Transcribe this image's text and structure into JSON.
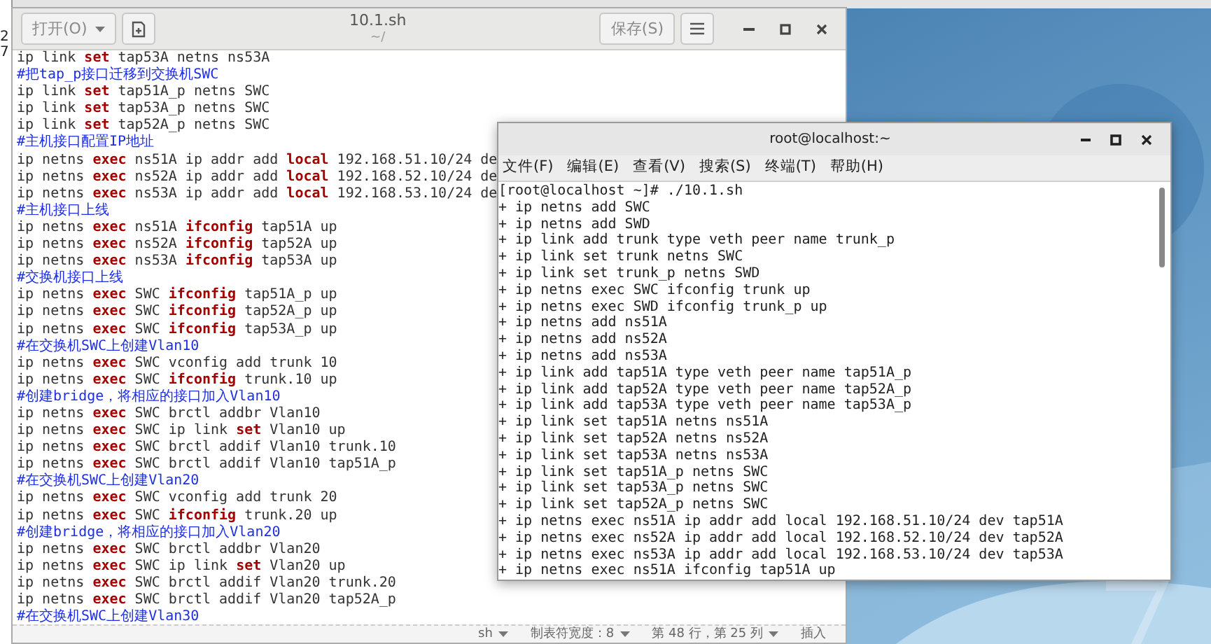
{
  "background_window": {
    "fragments": [
      "2",
      "7"
    ]
  },
  "editor": {
    "open_button": "打开(O)",
    "title": "10.1.sh",
    "subtitle": "~/",
    "save_button": "保存(S)",
    "lines": [
      {
        "kind": "code",
        "text": "ip link **set** tap53A netns ns53A"
      },
      {
        "kind": "comment",
        "text": "#把tap_p接口迁移到交换机SWC"
      },
      {
        "kind": "code",
        "text": "ip link **set** tap51A_p netns SWC"
      },
      {
        "kind": "code",
        "text": "ip link **set** tap53A_p netns SWC"
      },
      {
        "kind": "code",
        "text": "ip link **set** tap52A_p netns SWC"
      },
      {
        "kind": "comment",
        "text": "#主机接口配置IP地址"
      },
      {
        "kind": "code",
        "text": "ip netns **exec** ns51A ip addr add **local** 192.168.51.10/24 de"
      },
      {
        "kind": "code",
        "text": "ip netns **exec** ns52A ip addr add **local** 192.168.52.10/24 de"
      },
      {
        "kind": "code",
        "text": "ip netns **exec** ns53A ip addr add **local** 192.168.53.10/24 de"
      },
      {
        "kind": "comment",
        "text": "#主机接口上线"
      },
      {
        "kind": "code",
        "text": "ip netns **exec** ns51A **ifconfig** tap51A up"
      },
      {
        "kind": "code",
        "text": "ip netns **exec** ns52A **ifconfig** tap52A up"
      },
      {
        "kind": "code",
        "text": "ip netns **exec** ns53A **ifconfig** tap53A up"
      },
      {
        "kind": "comment",
        "text": "#交换机接口上线"
      },
      {
        "kind": "code",
        "text": "ip netns **exec** SWC **ifconfig** tap51A_p up"
      },
      {
        "kind": "code",
        "text": "ip netns **exec** SWC **ifconfig** tap52A_p up"
      },
      {
        "kind": "code",
        "text": "ip netns **exec** SWC **ifconfig** tap53A_p up"
      },
      {
        "kind": "comment",
        "text": "#在交换机SWC上创建Vlan10"
      },
      {
        "kind": "code",
        "text": "ip netns **exec** SWC vconfig add trunk 10"
      },
      {
        "kind": "code",
        "text": "ip netns **exec** SWC **ifconfig** trunk.10 up"
      },
      {
        "kind": "comment",
        "text": "#创建bridge，将相应的接口加入Vlan10"
      },
      {
        "kind": "code",
        "text": "ip netns **exec** SWC brctl addbr Vlan10"
      },
      {
        "kind": "code",
        "text": "ip netns **exec** SWC ip link **set** Vlan10 up"
      },
      {
        "kind": "code",
        "text": "ip netns **exec** SWC brctl addif Vlan10 trunk.10"
      },
      {
        "kind": "code",
        "text": "ip netns **exec** SWC brctl addif Vlan10 tap51A_p"
      },
      {
        "kind": "comment",
        "text": "#在交换机SWC上创建Vlan20"
      },
      {
        "kind": "code",
        "text": "ip netns **exec** SWC vconfig add trunk 20"
      },
      {
        "kind": "code",
        "text": "ip netns **exec** SWC **ifconfig** trunk.20 up"
      },
      {
        "kind": "comment",
        "text": "#创建bridge，将相应的接口加入Vlan20"
      },
      {
        "kind": "code",
        "text": "ip netns **exec** SWC brctl addbr Vlan20"
      },
      {
        "kind": "code",
        "text": "ip netns **exec** SWC ip link **set** Vlan20 up"
      },
      {
        "kind": "code",
        "text": "ip netns **exec** SWC brctl addif Vlan20 trunk.20"
      },
      {
        "kind": "code",
        "text": "ip netns **exec** SWC brctl addif Vlan20 tap52A_p"
      },
      {
        "kind": "comment",
        "text": "#在交换机SWC上创建Vlan30"
      }
    ],
    "status_bar": [
      {
        "kind": "dropdown",
        "label": "sh"
      },
      {
        "kind": "dropdown",
        "label": "制表符宽度：8"
      },
      {
        "kind": "dropdown",
        "label": "第 48 行，第 25 列"
      },
      {
        "kind": "text",
        "label": "插入"
      }
    ]
  },
  "terminal": {
    "title": "root@localhost:~",
    "menu": [
      "文件(F)",
      "编辑(E)",
      "查看(V)",
      "搜索(S)",
      "终端(T)",
      "帮助(H)"
    ],
    "lines": [
      "[root@localhost ~]# ./10.1.sh",
      "+ ip netns add SWC",
      "+ ip netns add SWD",
      "+ ip link add trunk type veth peer name trunk_p",
      "+ ip link set trunk netns SWC",
      "+ ip link set trunk_p netns SWD",
      "+ ip netns exec SWC ifconfig trunk up",
      "+ ip netns exec SWD ifconfig trunk_p up",
      "+ ip netns add ns51A",
      "+ ip netns add ns52A",
      "+ ip netns add ns53A",
      "+ ip link add tap51A type veth peer name tap51A_p",
      "+ ip link add tap52A type veth peer name tap52A_p",
      "+ ip link add tap53A type veth peer name tap53A_p",
      "+ ip link set tap51A netns ns51A",
      "+ ip link set tap52A netns ns52A",
      "+ ip link set tap53A netns ns53A",
      "+ ip link set tap51A_p netns SWC",
      "+ ip link set tap53A_p netns SWC",
      "+ ip link set tap52A_p netns SWC",
      "+ ip netns exec ns51A ip addr add local 192.168.51.10/24 dev tap51A",
      "+ ip netns exec ns52A ip addr add local 192.168.52.10/24 dev tap52A",
      "+ ip netns exec ns53A ip addr add local 192.168.53.10/24 dev tap53A",
      "+ ip netns exec ns51A ifconfig tap51A up"
    ]
  }
}
